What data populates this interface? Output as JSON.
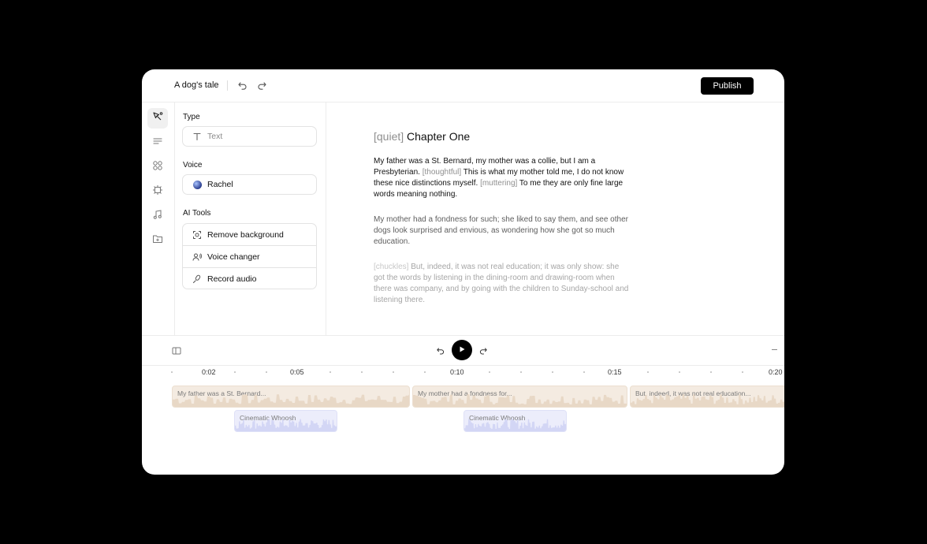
{
  "header": {
    "title": "A dog's tale",
    "publish_label": "Publish"
  },
  "rail": {
    "items": [
      {
        "name": "pen-tool-icon",
        "active": true
      },
      {
        "name": "text-lines-icon",
        "active": false
      },
      {
        "name": "grid-icon",
        "active": false
      },
      {
        "name": "settings-gear-icon",
        "active": false
      },
      {
        "name": "music-note-icon",
        "active": false
      },
      {
        "name": "folder-add-icon",
        "active": false
      }
    ]
  },
  "panel": {
    "type_label": "Type",
    "type_placeholder": "Text",
    "voice_label": "Voice",
    "voice_value": "Rachel",
    "tools_label": "AI Tools",
    "tools": [
      {
        "label": "Remove background",
        "icon": "remove-background-icon"
      },
      {
        "label": "Voice changer",
        "icon": "voice-changer-icon"
      },
      {
        "label": "Record audio",
        "icon": "microphone-icon"
      }
    ]
  },
  "editor": {
    "chapter_tag": "[quiet]",
    "chapter_title": "Chapter One",
    "p1": {
      "a": "My father was a St. Bernard, my mother was a collie, but I am a Presbyterian.",
      "tag1": "[thoughtful]",
      "b": "This is what my mother told me, I do not know these nice distinctions myself.",
      "tag2": "[muttering]",
      "c": "To me they are only fine large words meaning nothing."
    },
    "p2": "My mother had a fondness for such; she liked to say them, and see other dogs look surprised and envious, as wondering how she got so much education.",
    "p3": {
      "tag": "[chuckles]",
      "text": "But, indeed, it was not real education; it was only show: she got the words by listening in the dining-room and drawing-room when there was company, and by going with the children to Sunday-school and listening there."
    }
  },
  "timeline": {
    "ticks": [
      "0:02",
      "0:05",
      "0:10",
      "0:15",
      "0:20"
    ],
    "voice_clips": [
      "My father was a St. Bernard...",
      "My mother had a fondness for...",
      "But, indeed, it was not real education..."
    ],
    "sfx_clips": [
      "Cinematic Whoosh",
      "Cinematic Whoosh"
    ]
  },
  "colors": {
    "voice_clip": "#f4ebe1",
    "sfx_clip": "#ecedfb",
    "accent": "#000000"
  }
}
